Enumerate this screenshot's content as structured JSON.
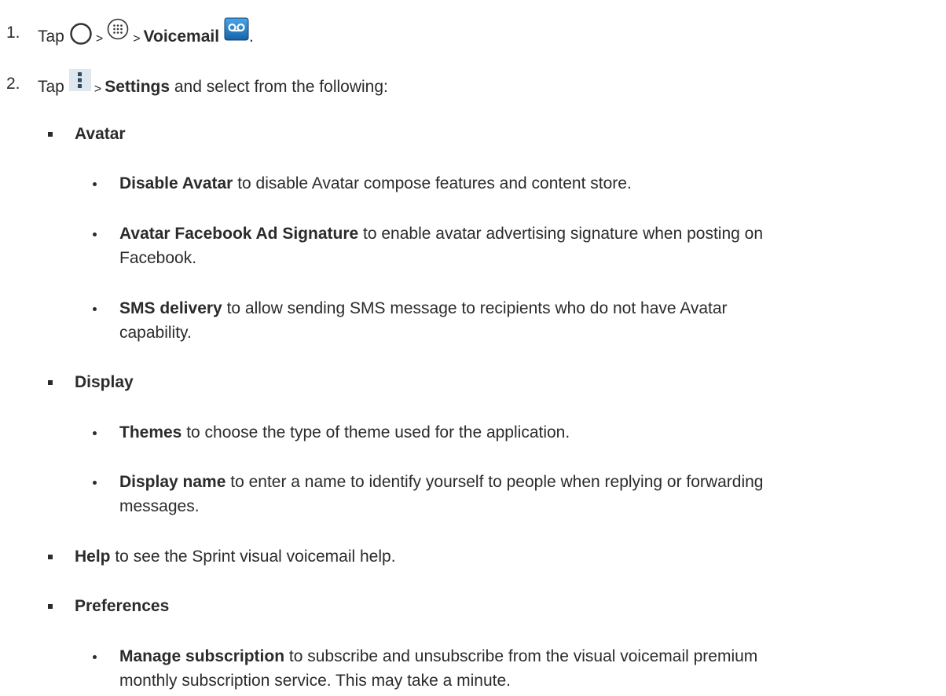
{
  "step1": {
    "number": "1.",
    "tap": "Tap",
    "sep1": ">",
    "sep2": ">",
    "voicemail": "Voicemail",
    "period": ".",
    "icons": [
      "home-circle-icon",
      "apps-grid-icon",
      "voicemail-app-icon"
    ]
  },
  "step2": {
    "number": "2.",
    "tap": "Tap",
    "sep": ">",
    "settings": "Settings",
    "rest": " and select from the following:",
    "icons": [
      "menu-dots-icon"
    ]
  },
  "sections": {
    "avatar": {
      "title": "Avatar",
      "items": [
        {
          "bold": "Disable Avatar",
          "text": " to disable Avatar compose features and content store."
        },
        {
          "bold": "Avatar Facebook Ad Signature",
          "text": " to enable avatar advertising signature when posting on",
          "cont": "Facebook."
        },
        {
          "bold": "SMS delivery",
          "text": " to allow sending SMS message to recipients who do not have Avatar",
          "cont": "capability."
        }
      ]
    },
    "display": {
      "title": "Display",
      "items": [
        {
          "bold": "Themes",
          "text": " to choose the type of theme used for the application."
        },
        {
          "bold": "Display name",
          "text": " to enter a name to identify yourself to people when replying or forwarding",
          "cont": "messages."
        }
      ]
    },
    "help": {
      "bold": "Help",
      "text": " to see the Sprint visual voicemail help."
    },
    "preferences": {
      "title": "Preferences",
      "items": [
        {
          "bold": "Manage subscription",
          "text": " to subscribe and unsubscribe from the visual voicemail premium",
          "cont": "monthly subscription service. This may take a minute."
        }
      ]
    }
  }
}
